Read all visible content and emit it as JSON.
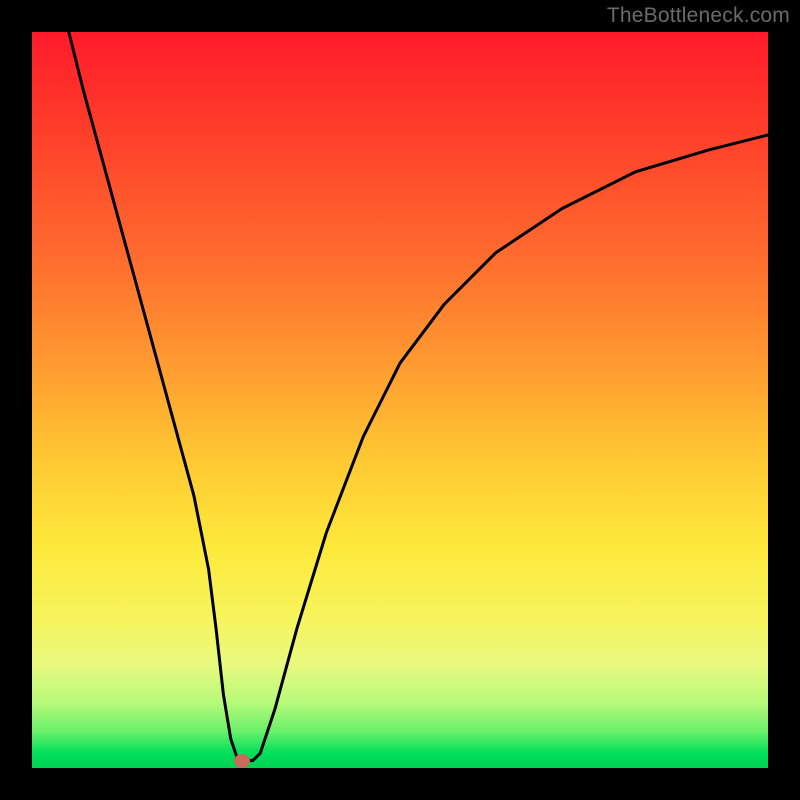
{
  "watermark": "TheBottleneck.com",
  "chart_data": {
    "type": "line",
    "title": "",
    "xlabel": "",
    "ylabel": "",
    "xlim": [
      0,
      100
    ],
    "ylim": [
      0,
      100
    ],
    "grid": false,
    "series": [
      {
        "name": "curve",
        "x": [
          5,
          7,
          10,
          13,
          16,
          19,
          22,
          24,
          25,
          26,
          27,
          28,
          29,
          30,
          31,
          33,
          36,
          40,
          45,
          50,
          56,
          63,
          72,
          82,
          92,
          100
        ],
        "values": [
          100,
          92,
          81,
          70,
          59,
          48,
          37,
          27,
          19,
          10,
          4,
          1,
          1,
          1,
          2,
          8,
          19,
          32,
          45,
          55,
          63,
          70,
          76,
          81,
          84,
          86
        ]
      }
    ],
    "marker": {
      "x": 28.5,
      "y": 1
    },
    "colors": {
      "curve": "#000000",
      "marker": "#c96a5a",
      "gradient_stops": [
        "#ff1a2a",
        "#ff6a2e",
        "#ffc832",
        "#f6f55e",
        "#00d050"
      ]
    }
  }
}
